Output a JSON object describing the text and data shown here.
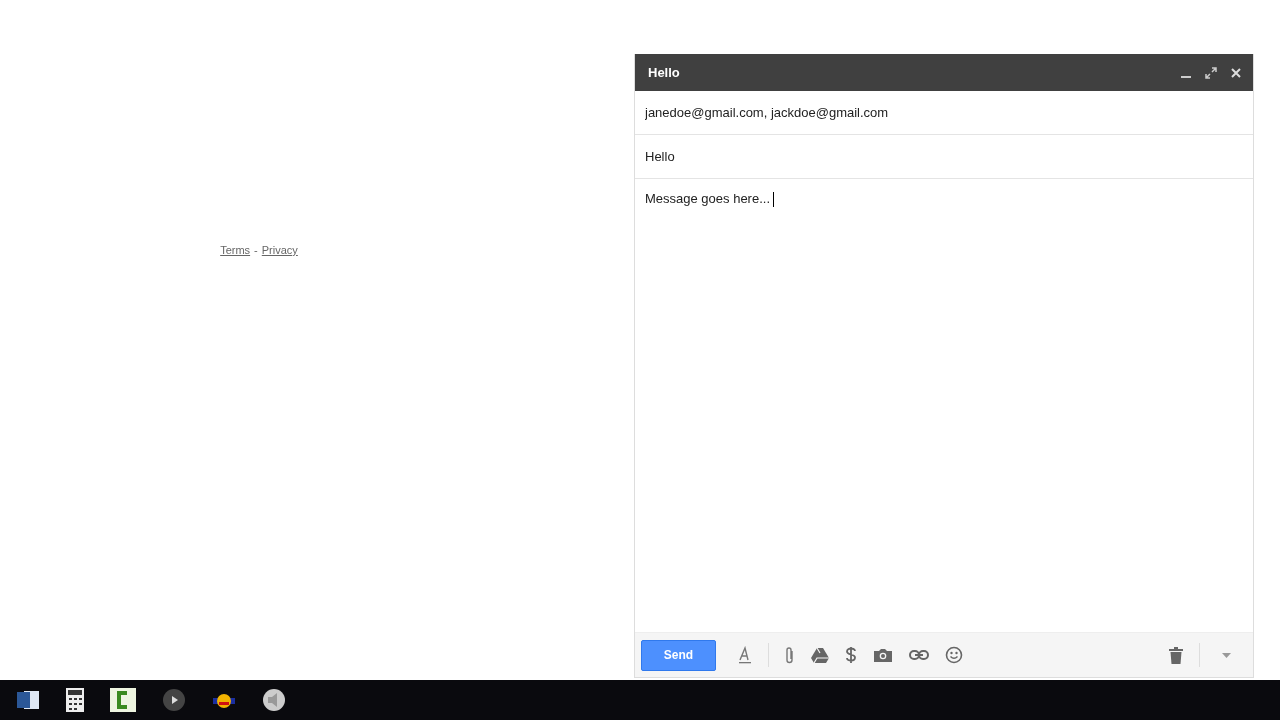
{
  "footer_links": [
    {
      "label": "Terms"
    },
    {
      "label": "Privacy"
    }
  ],
  "footer_separator": "-",
  "compose": {
    "title": "Hello",
    "to": "janedoe@gmail.com, jackdoe@gmail.com",
    "subject": "Hello",
    "body": "Message goes here...",
    "send_label": "Send"
  },
  "taskbar": {
    "apps": [
      {
        "kind": "word"
      },
      {
        "kind": "calculator"
      },
      {
        "kind": "recorder"
      },
      {
        "kind": "media"
      },
      {
        "kind": "paint"
      },
      {
        "kind": "speaker"
      }
    ]
  }
}
